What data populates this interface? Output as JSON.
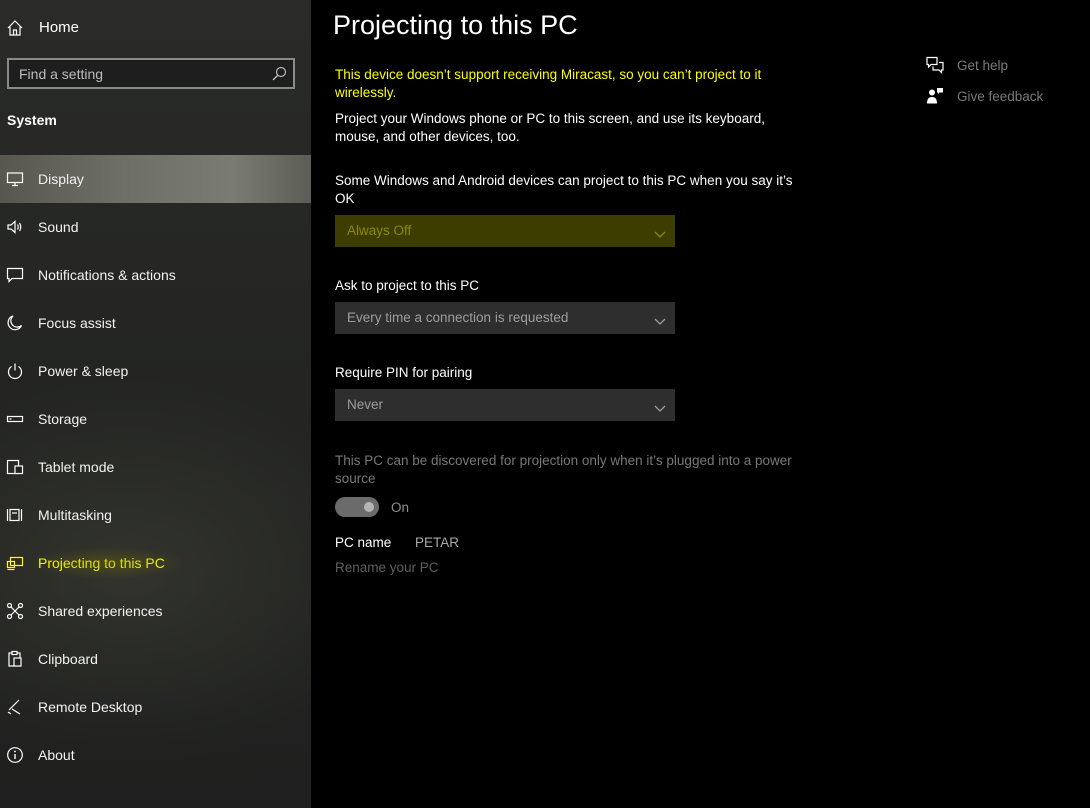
{
  "sidebar": {
    "home_label": "Home",
    "search_placeholder": "Find a setting",
    "section_title": "System",
    "items": [
      {
        "label": "Display",
        "icon": "monitor-icon"
      },
      {
        "label": "Sound",
        "icon": "speaker-icon"
      },
      {
        "label": "Notifications & actions",
        "icon": "message-icon"
      },
      {
        "label": "Focus assist",
        "icon": "moon-icon"
      },
      {
        "label": "Power & sleep",
        "icon": "power-icon"
      },
      {
        "label": "Storage",
        "icon": "drive-icon"
      },
      {
        "label": "Tablet mode",
        "icon": "tablet-mode-icon"
      },
      {
        "label": "Multitasking",
        "icon": "multitasking-icon"
      },
      {
        "label": "Projecting to this PC",
        "icon": "projecting-icon"
      },
      {
        "label": "Shared experiences",
        "icon": "share-icon"
      },
      {
        "label": "Clipboard",
        "icon": "clipboard-icon"
      },
      {
        "label": "Remote Desktop",
        "icon": "remote-desktop-icon"
      },
      {
        "label": "About",
        "icon": "info-icon"
      }
    ],
    "hover_item": "Display",
    "active_item": "Projecting to this PC"
  },
  "main": {
    "title": "Projecting to this PC",
    "warning": "This device doesn’t support receiving Miracast, so you can’t project to it wirelessly.",
    "description": "Project your Windows phone or PC to this screen, and use its keyboard, mouse, and other devices, too.",
    "setting1": {
      "label": "Some Windows and Android devices can project to this PC when you say it’s OK",
      "value": "Always Off"
    },
    "setting2": {
      "label": "Ask to project to this PC",
      "value": "Every time a connection is requested"
    },
    "setting3": {
      "label": "Require PIN for pairing",
      "value": "Never"
    },
    "power_note": "This PC can be discovered for projection only when it’s plugged into a power source",
    "toggle_label": "On",
    "toggle_on": true,
    "pc_name_label": "PC name",
    "pc_name_value": "PETAR",
    "rename_link": "Rename your PC"
  },
  "help": {
    "get_help": "Get help",
    "give_feedback": "Give feedback"
  },
  "colors": {
    "accent_highlight": "#ffff00",
    "dropdown_highlight_bg": "#3e3d00",
    "background": "#000000"
  }
}
